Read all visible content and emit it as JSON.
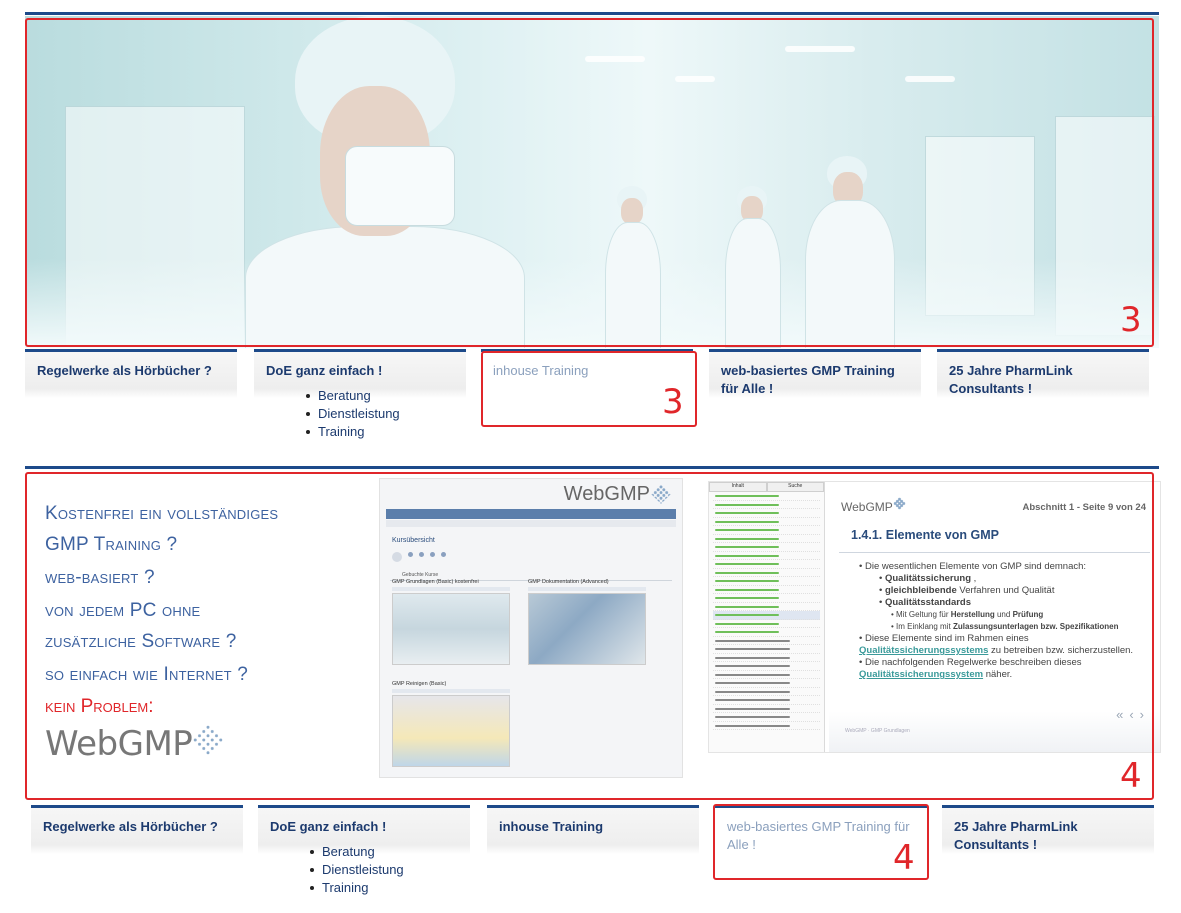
{
  "section1": {
    "marker_hero": "3",
    "marker_tab": "3",
    "tabs": [
      {
        "label": "Regelwerke als Hörbücher ?",
        "active": false
      },
      {
        "label": "DoE ganz einfach !",
        "active": false,
        "items": [
          "Beratung",
          "Dienstleistung",
          "Training"
        ]
      },
      {
        "label": "inhouse Training",
        "active": true
      },
      {
        "label": "web-basiertes GMP Training für Alle !",
        "active": false
      },
      {
        "label": "25 Jahre PharmLink Consultants !",
        "active": false
      }
    ]
  },
  "section2": {
    "marker_panel": "4",
    "marker_tab": "4",
    "headline": [
      "Kostenfrei ein vollständiges",
      "GMP Training ?",
      "web-basiert ?",
      "von jedem PC ohne",
      "zusätzliche Software ?",
      "so einfach wie Internet ?"
    ],
    "headline_red": "kein Problem:",
    "logo_text": "WebGMP",
    "screenshot1": {
      "logo": "WebGMP",
      "title": "Kursübersicht",
      "subtitle": "Gebuchte Kurse",
      "courses": [
        "GMP Grundlagen (Basic) kostenfrei",
        "GMP Dokumentation (Advanced)",
        "GMP Reinigen (Basic)"
      ]
    },
    "screenshot2": {
      "toc_tabs": [
        "Inhalt",
        "Suche"
      ],
      "logo": "WebGMP",
      "page_number": "Abschnitt 1 - Seite 9 von 24",
      "heading": "1.4.1. Elemente von GMP",
      "body": {
        "intro": "Die wesentlichen Elemente von GMP sind demnach:",
        "e1": "Qualitätssicherung",
        "e1_tail": ",",
        "e2": "gleichbleibende",
        "e2_tail": "Verfahren und Qualität",
        "e3": "Qualitätsstandards",
        "sub1_pre": "Mit Geltung für",
        "sub1_b1": "Herstellung",
        "sub1_mid": "und",
        "sub1_b2": "Prüfung",
        "sub2_pre": "Im Einklang mit",
        "sub2_b": "Zulassungsunterlagen bzw. Spezifikationen",
        "p2_pre": "Diese Elemente sind im Rahmen eines",
        "p2_link": "Qualitätssicherungssystems",
        "p2_tail": "zu betreiben bzw. sicherzustellen.",
        "p3_pre": "Die nachfolgenden Regelwerke beschreiben dieses",
        "p3_link": "Qualitätssicherungssystem",
        "p3_tail": "näher."
      },
      "footer": "WebGMP · GMP Grundlagen"
    },
    "tabs": [
      {
        "label": "Regelwerke als Hörbücher ?",
        "active": false
      },
      {
        "label": "DoE ganz einfach !",
        "active": false,
        "items": [
          "Beratung",
          "Dienstleistung",
          "Training"
        ]
      },
      {
        "label": "inhouse Training",
        "active": false
      },
      {
        "label": "web-basiertes GMP Training für Alle !",
        "active": true
      },
      {
        "label": "25 Jahre PharmLink Consultants !",
        "active": false
      }
    ]
  },
  "colors": {
    "accent_blue": "#1d4a8a",
    "link_navy": "#1c3a6e",
    "active_tab": "#8ba0bd",
    "highlight_red": "#e0262a"
  }
}
